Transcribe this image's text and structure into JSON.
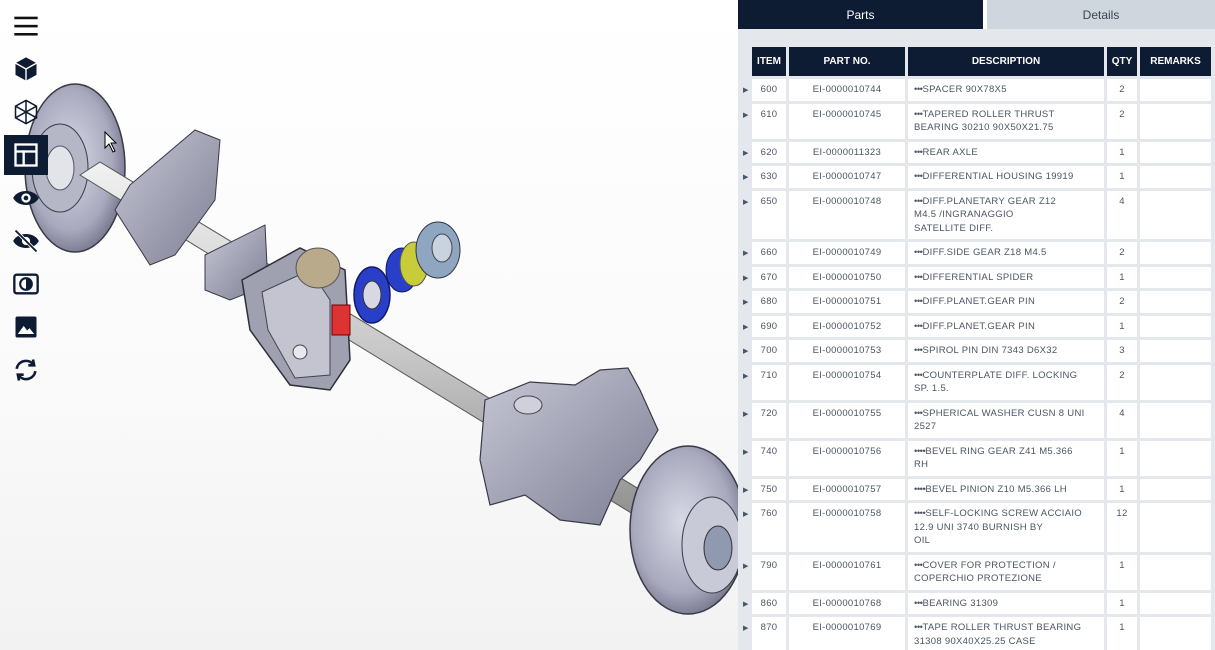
{
  "tabs": {
    "parts": "Parts",
    "details": "Details"
  },
  "toolbar": [
    {
      "name": "menu-icon"
    },
    {
      "name": "cube-solid-icon"
    },
    {
      "name": "cube-wireframe-icon"
    },
    {
      "name": "table-layout-icon",
      "active": true
    },
    {
      "name": "eye-icon"
    },
    {
      "name": "eye-off-icon"
    },
    {
      "name": "contrast-icon"
    },
    {
      "name": "image-icon"
    },
    {
      "name": "sync-icon"
    }
  ],
  "table": {
    "headers": [
      "ITEM",
      "PART NO.",
      "DESCRIPTION",
      "QTY",
      "REMARKS"
    ],
    "rows": [
      {
        "item": "600",
        "part": "EI-0000010744",
        "prefix": "•••",
        "desc": "SPACER 90X78X5",
        "qty": "2",
        "remarks": ""
      },
      {
        "item": "610",
        "part": "EI-0000010745",
        "prefix": "•••",
        "desc": "TAPERED ROLLER THRUST\nBEARING 30210 90X50X21.75",
        "qty": "2",
        "remarks": ""
      },
      {
        "item": "620",
        "part": "EI-0000011323",
        "prefix": "•••",
        "desc": "REAR AXLE",
        "qty": "1",
        "remarks": ""
      },
      {
        "item": "630",
        "part": "EI-0000010747",
        "prefix": "•••",
        "desc": "DIFFERENTIAL HOUSING 19919",
        "qty": "1",
        "remarks": ""
      },
      {
        "item": "650",
        "part": "EI-0000010748",
        "prefix": "•••",
        "desc": "DIFF.PLANETARY GEAR Z12\nM4.5 /INGRANAGGIO\nSATELLITE DIFF.",
        "qty": "4",
        "remarks": ""
      },
      {
        "item": "660",
        "part": "EI-0000010749",
        "prefix": "•••",
        "desc": "DIFF.SIDE GEAR Z18 M4.5",
        "qty": "2",
        "remarks": ""
      },
      {
        "item": "670",
        "part": "EI-0000010750",
        "prefix": "•••",
        "desc": "DIFFERENTIAL SPIDER",
        "qty": "1",
        "remarks": ""
      },
      {
        "item": "680",
        "part": "EI-0000010751",
        "prefix": "•••",
        "desc": "DIFF.PLANET.GEAR PIN",
        "qty": "2",
        "remarks": ""
      },
      {
        "item": "690",
        "part": "EI-0000010752",
        "prefix": "•••",
        "desc": "DIFF.PLANET.GEAR PIN",
        "qty": "1",
        "remarks": ""
      },
      {
        "item": "700",
        "part": "EI-0000010753",
        "prefix": "•••",
        "desc": "SPIROL PIN DIN 7343 D6X32",
        "qty": "3",
        "remarks": ""
      },
      {
        "item": "710",
        "part": "EI-0000010754",
        "prefix": "•••",
        "desc": "COUNTERPLATE DIFF. LOCKING\nSP. 1.5.",
        "qty": "2",
        "remarks": ""
      },
      {
        "item": "720",
        "part": "EI-0000010755",
        "prefix": "•••",
        "desc": "SPHERICAL WASHER CUSN 8 UNI\n2527",
        "qty": "4",
        "remarks": ""
      },
      {
        "item": "740",
        "part": "EI-0000010756",
        "prefix": "••••",
        "desc": "BEVEL RING GEAR Z41 M5.366\nRH",
        "qty": "1",
        "remarks": ""
      },
      {
        "item": "750",
        "part": "EI-0000010757",
        "prefix": "••••",
        "desc": "BEVEL PINION Z10 M5.366 LH",
        "qty": "1",
        "remarks": ""
      },
      {
        "item": "760",
        "part": "EI-0000010758",
        "prefix": "••••",
        "desc": "SELF-LOCKING SCREW ACCIAIO\n12.9 UNI 3740 BURNISH BY\nOIL",
        "qty": "12",
        "remarks": ""
      },
      {
        "item": "790",
        "part": "EI-0000010761",
        "prefix": "•••",
        "desc": "COVER FOR PROTECTION /\nCOPERCHIO PROTEZIONE",
        "qty": "1",
        "remarks": ""
      },
      {
        "item": "860",
        "part": "EI-0000010768",
        "prefix": "•••",
        "desc": "BEARING 31309",
        "qty": "1",
        "remarks": ""
      },
      {
        "item": "870",
        "part": "EI-0000010769",
        "prefix": "•••",
        "desc": "TAPE ROLLER THRUST BEARING\n31308 90X40X25.25 CASE",
        "qty": "1",
        "remarks": ""
      }
    ]
  }
}
